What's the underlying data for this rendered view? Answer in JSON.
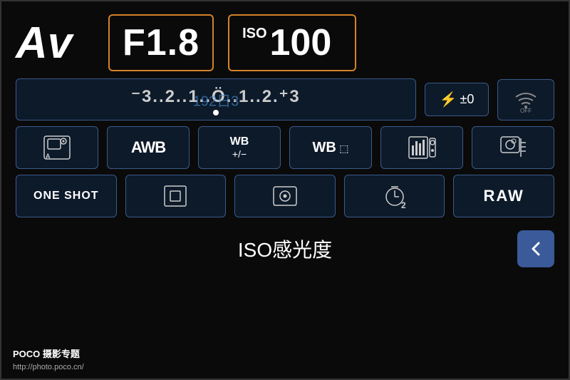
{
  "header": {
    "mode": "Av",
    "aperture": "F1.8",
    "iso_label": "ISO",
    "iso_value": "100"
  },
  "ev_row": {
    "scale": "⁻3..2..1..0..1..2.⁺3",
    "flash": "⚡±0",
    "wifi": "((•)) OFF",
    "watermark": "192日3"
  },
  "row2": {
    "cells": [
      {
        "id": "metering",
        "symbol": "☀A"
      },
      {
        "id": "wb-auto",
        "symbol": "AWB"
      },
      {
        "id": "wb-shift",
        "symbol": "WB\n+/−"
      },
      {
        "id": "wb-bracket",
        "symbol": "WB⬚"
      },
      {
        "id": "picture-style",
        "symbol": "📊"
      },
      {
        "id": "custom",
        "symbol": "📷≡"
      }
    ]
  },
  "row3": {
    "cells": [
      {
        "id": "one-shot",
        "symbol": "ONE SHOT"
      },
      {
        "id": "af-point",
        "symbol": "⊡"
      },
      {
        "id": "live-view",
        "symbol": "⊙"
      },
      {
        "id": "self-timer",
        "symbol": "⏱2"
      },
      {
        "id": "raw",
        "symbol": "RAW"
      }
    ]
  },
  "bottom": {
    "label": "ISO感光度"
  },
  "branding": {
    "title": "POCO 摄影专题",
    "url": "http://photo.poco.cn/"
  },
  "colors": {
    "orange_border": "#d4822a",
    "blue_border": "#3a5a8a",
    "back_btn": "#3a5a9a",
    "bg": "#0a0a0a",
    "cell_bg": "#0d1a2a"
  }
}
